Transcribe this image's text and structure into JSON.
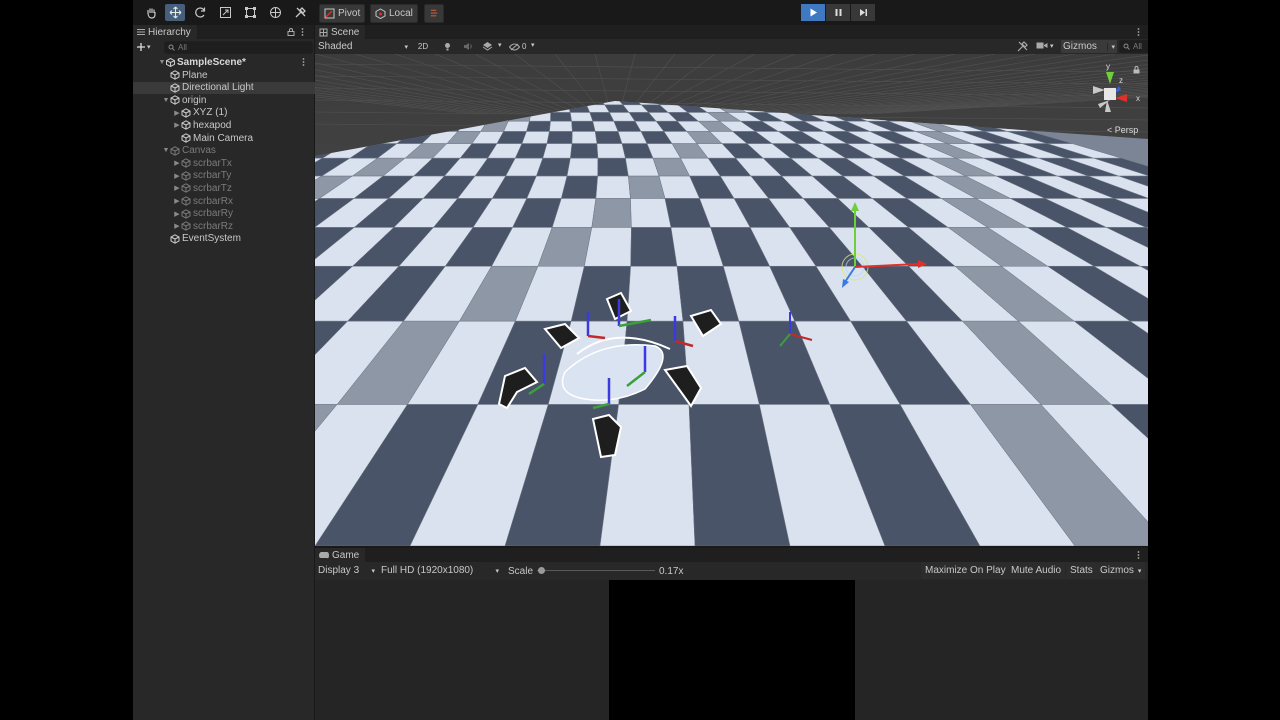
{
  "toolbar": {
    "tools": [
      "hand-tool",
      "move-tool",
      "rotate-tool",
      "scale-tool",
      "rect-tool",
      "transform-tool",
      "custom-tool"
    ],
    "pivot_label": "Pivot",
    "local_label": "Local"
  },
  "hierarchy": {
    "tab_label": "Hierarchy",
    "search_placeholder": "All",
    "scene_name": "SampleScene*",
    "items": [
      {
        "label": "Plane"
      },
      {
        "label": "Directional Light"
      },
      {
        "label": "origin"
      },
      {
        "label": "XYZ (1)"
      },
      {
        "label": "hexapod"
      },
      {
        "label": "Main Camera"
      },
      {
        "label": "Canvas"
      },
      {
        "label": "scrbarTx"
      },
      {
        "label": "scrbarTy"
      },
      {
        "label": "scrbarTz"
      },
      {
        "label": "scrbarRx"
      },
      {
        "label": "scrbarRy"
      },
      {
        "label": "scrbarRz"
      },
      {
        "label": "EventSystem"
      }
    ]
  },
  "scene": {
    "tab_label": "Scene",
    "shading_mode": "Shaded",
    "mode_2d": "2D",
    "hidden_count": "0",
    "gizmos_label": "Gizmos",
    "search_placeholder": "All",
    "orientation": {
      "y": "y",
      "x": "x",
      "z": "z",
      "projection": "< Persp"
    }
  },
  "game": {
    "tab_label": "Game",
    "display": "Display 3",
    "resolution": "Full HD (1920x1080)",
    "scale_label": "Scale",
    "scale_value": "0.17x",
    "maximize": "Maximize On Play",
    "mute": "Mute Audio",
    "stats": "Stats",
    "gizmos": "Gizmos"
  },
  "colors": {
    "accent_play": "#3e79c2",
    "selection": "#46607c",
    "axis_x": "#e0302a",
    "axis_y": "#6fcf3a",
    "axis_z": "#3a5fe0"
  }
}
